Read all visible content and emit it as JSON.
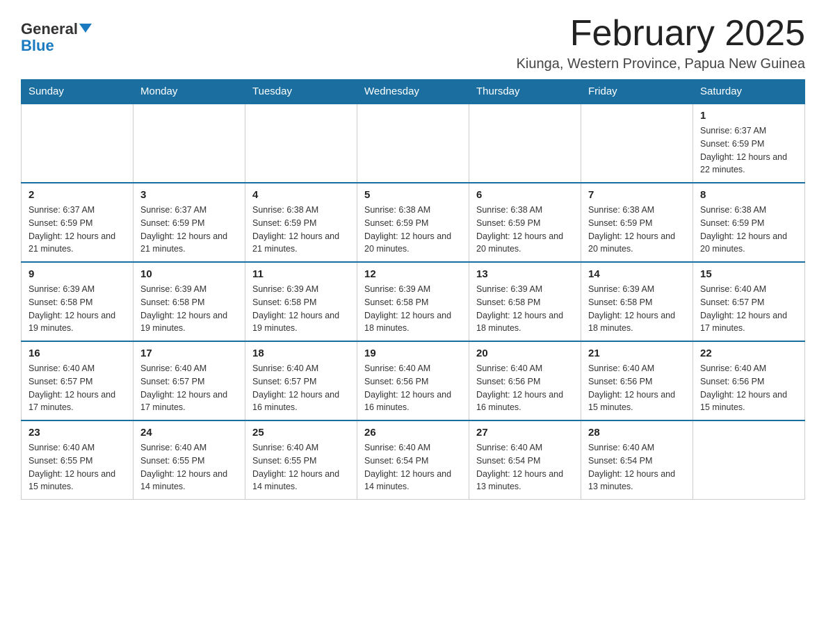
{
  "header": {
    "logo_general": "General",
    "logo_blue": "Blue",
    "month_title": "February 2025",
    "location": "Kiunga, Western Province, Papua New Guinea"
  },
  "days_of_week": [
    "Sunday",
    "Monday",
    "Tuesday",
    "Wednesday",
    "Thursday",
    "Friday",
    "Saturday"
  ],
  "weeks": [
    [
      {
        "day": "",
        "info": ""
      },
      {
        "day": "",
        "info": ""
      },
      {
        "day": "",
        "info": ""
      },
      {
        "day": "",
        "info": ""
      },
      {
        "day": "",
        "info": ""
      },
      {
        "day": "",
        "info": ""
      },
      {
        "day": "1",
        "info": "Sunrise: 6:37 AM\nSunset: 6:59 PM\nDaylight: 12 hours and 22 minutes."
      }
    ],
    [
      {
        "day": "2",
        "info": "Sunrise: 6:37 AM\nSunset: 6:59 PM\nDaylight: 12 hours and 21 minutes."
      },
      {
        "day": "3",
        "info": "Sunrise: 6:37 AM\nSunset: 6:59 PM\nDaylight: 12 hours and 21 minutes."
      },
      {
        "day": "4",
        "info": "Sunrise: 6:38 AM\nSunset: 6:59 PM\nDaylight: 12 hours and 21 minutes."
      },
      {
        "day": "5",
        "info": "Sunrise: 6:38 AM\nSunset: 6:59 PM\nDaylight: 12 hours and 20 minutes."
      },
      {
        "day": "6",
        "info": "Sunrise: 6:38 AM\nSunset: 6:59 PM\nDaylight: 12 hours and 20 minutes."
      },
      {
        "day": "7",
        "info": "Sunrise: 6:38 AM\nSunset: 6:59 PM\nDaylight: 12 hours and 20 minutes."
      },
      {
        "day": "8",
        "info": "Sunrise: 6:38 AM\nSunset: 6:59 PM\nDaylight: 12 hours and 20 minutes."
      }
    ],
    [
      {
        "day": "9",
        "info": "Sunrise: 6:39 AM\nSunset: 6:58 PM\nDaylight: 12 hours and 19 minutes."
      },
      {
        "day": "10",
        "info": "Sunrise: 6:39 AM\nSunset: 6:58 PM\nDaylight: 12 hours and 19 minutes."
      },
      {
        "day": "11",
        "info": "Sunrise: 6:39 AM\nSunset: 6:58 PM\nDaylight: 12 hours and 19 minutes."
      },
      {
        "day": "12",
        "info": "Sunrise: 6:39 AM\nSunset: 6:58 PM\nDaylight: 12 hours and 18 minutes."
      },
      {
        "day": "13",
        "info": "Sunrise: 6:39 AM\nSunset: 6:58 PM\nDaylight: 12 hours and 18 minutes."
      },
      {
        "day": "14",
        "info": "Sunrise: 6:39 AM\nSunset: 6:58 PM\nDaylight: 12 hours and 18 minutes."
      },
      {
        "day": "15",
        "info": "Sunrise: 6:40 AM\nSunset: 6:57 PM\nDaylight: 12 hours and 17 minutes."
      }
    ],
    [
      {
        "day": "16",
        "info": "Sunrise: 6:40 AM\nSunset: 6:57 PM\nDaylight: 12 hours and 17 minutes."
      },
      {
        "day": "17",
        "info": "Sunrise: 6:40 AM\nSunset: 6:57 PM\nDaylight: 12 hours and 17 minutes."
      },
      {
        "day": "18",
        "info": "Sunrise: 6:40 AM\nSunset: 6:57 PM\nDaylight: 12 hours and 16 minutes."
      },
      {
        "day": "19",
        "info": "Sunrise: 6:40 AM\nSunset: 6:56 PM\nDaylight: 12 hours and 16 minutes."
      },
      {
        "day": "20",
        "info": "Sunrise: 6:40 AM\nSunset: 6:56 PM\nDaylight: 12 hours and 16 minutes."
      },
      {
        "day": "21",
        "info": "Sunrise: 6:40 AM\nSunset: 6:56 PM\nDaylight: 12 hours and 15 minutes."
      },
      {
        "day": "22",
        "info": "Sunrise: 6:40 AM\nSunset: 6:56 PM\nDaylight: 12 hours and 15 minutes."
      }
    ],
    [
      {
        "day": "23",
        "info": "Sunrise: 6:40 AM\nSunset: 6:55 PM\nDaylight: 12 hours and 15 minutes."
      },
      {
        "day": "24",
        "info": "Sunrise: 6:40 AM\nSunset: 6:55 PM\nDaylight: 12 hours and 14 minutes."
      },
      {
        "day": "25",
        "info": "Sunrise: 6:40 AM\nSunset: 6:55 PM\nDaylight: 12 hours and 14 minutes."
      },
      {
        "day": "26",
        "info": "Sunrise: 6:40 AM\nSunset: 6:54 PM\nDaylight: 12 hours and 14 minutes."
      },
      {
        "day": "27",
        "info": "Sunrise: 6:40 AM\nSunset: 6:54 PM\nDaylight: 12 hours and 13 minutes."
      },
      {
        "day": "28",
        "info": "Sunrise: 6:40 AM\nSunset: 6:54 PM\nDaylight: 12 hours and 13 minutes."
      },
      {
        "day": "",
        "info": ""
      }
    ]
  ]
}
